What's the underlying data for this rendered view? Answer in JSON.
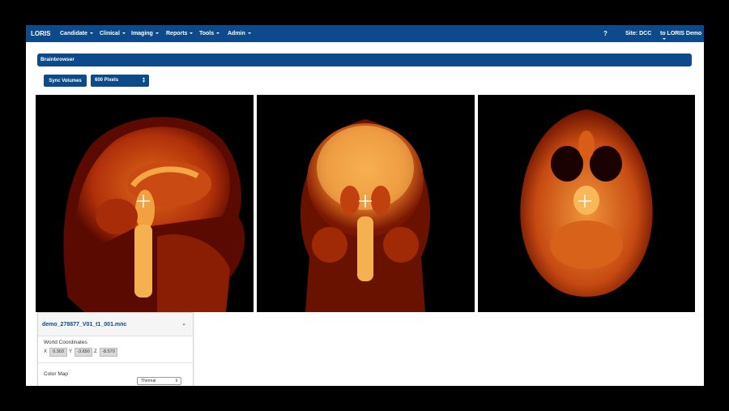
{
  "navbar": {
    "brand": "LORIS",
    "menus": [
      "Candidate",
      "Clinical",
      "Imaging",
      "Reports",
      "Tools",
      "Admin"
    ],
    "help_label": "?",
    "site_label": "Site: DCC",
    "user_label": "to LORIS Demo"
  },
  "panel": {
    "title": "Brainbrowser"
  },
  "controls": {
    "sync_label": "Sync Volumes",
    "size_value": "600 Pixels"
  },
  "views": [
    "sagittal",
    "coronal",
    "axial"
  ],
  "volume": {
    "filename": "demo_278877_V01_t1_001.mnc",
    "world_coords_label": "World Coordinates",
    "x_label": "X",
    "x_value": "0.303",
    "y_label": "Y",
    "y_value": "-3.650",
    "z_label": "Z",
    "z_value": "-8.570",
    "colormap_label": "Color Map",
    "colormap_value": "Thermal"
  },
  "colors": {
    "nav": "#0c4a8b",
    "thermal_dark": "#5a0a00",
    "thermal_mid": "#c0360a",
    "thermal_bright": "#f5a646"
  }
}
